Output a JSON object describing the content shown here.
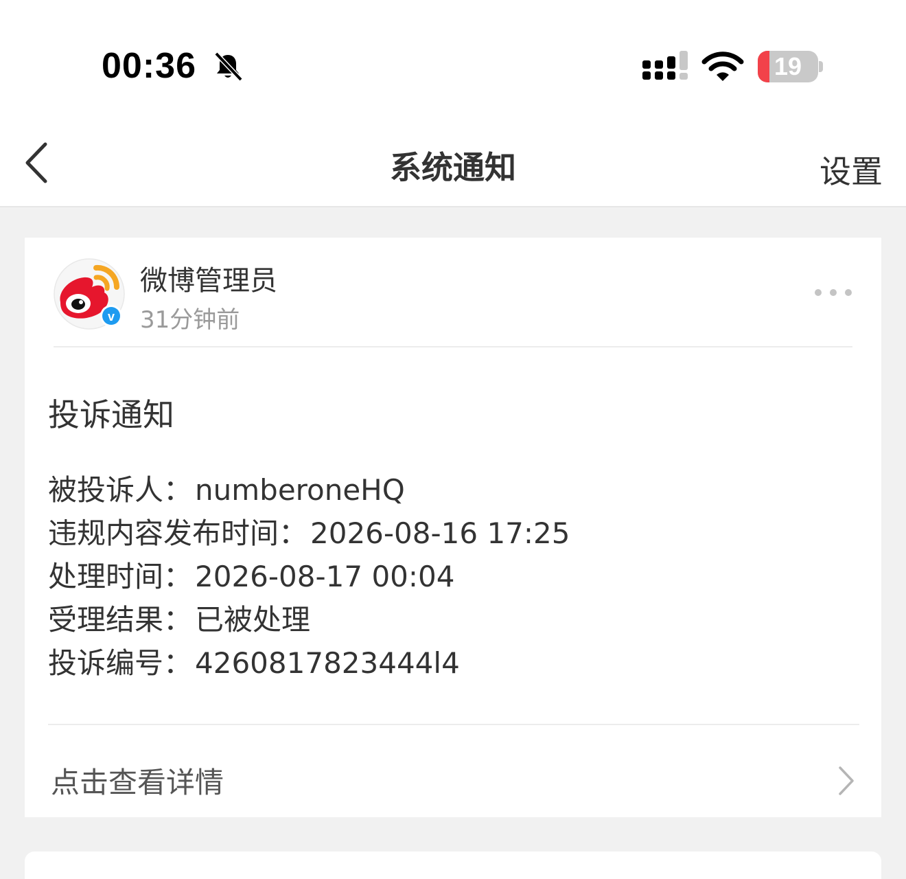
{
  "status_bar": {
    "time": "00:36",
    "battery_level": "19",
    "battery_fraction": 0.19,
    "icons": [
      "bell-slash-icon",
      "cellular-signal-icon",
      "wifi-icon",
      "battery-charging-icon"
    ]
  },
  "nav": {
    "title": "系统通知",
    "settings_label": "设置",
    "back_icon": "chevron-left-icon"
  },
  "message": {
    "sender_name": "微博管理员",
    "time_ago": "31分钟前",
    "avatar": "weibo-logo",
    "verified_badge": "v",
    "title": "投诉通知",
    "details": [
      {
        "label": "被投诉人：",
        "value": "numberoneHQ"
      },
      {
        "label": "违规内容发布时间：",
        "value": "2026-08-16 17:25"
      },
      {
        "label": "处理时间：",
        "value": "2026-08-17 00:04"
      },
      {
        "label": "受理结果：",
        "value": "已被处理"
      },
      {
        "label": "投诉编号：",
        "value": "4260817823444l4"
      }
    ],
    "link_label": "点击查看详情"
  },
  "colors": {
    "background": "#f1f1f1",
    "card": "#ffffff",
    "battery_red": "#f2424a",
    "verified_blue": "#1e9bf0",
    "weibo_red": "#e6162d",
    "weibo_orange": "#f5a623"
  }
}
